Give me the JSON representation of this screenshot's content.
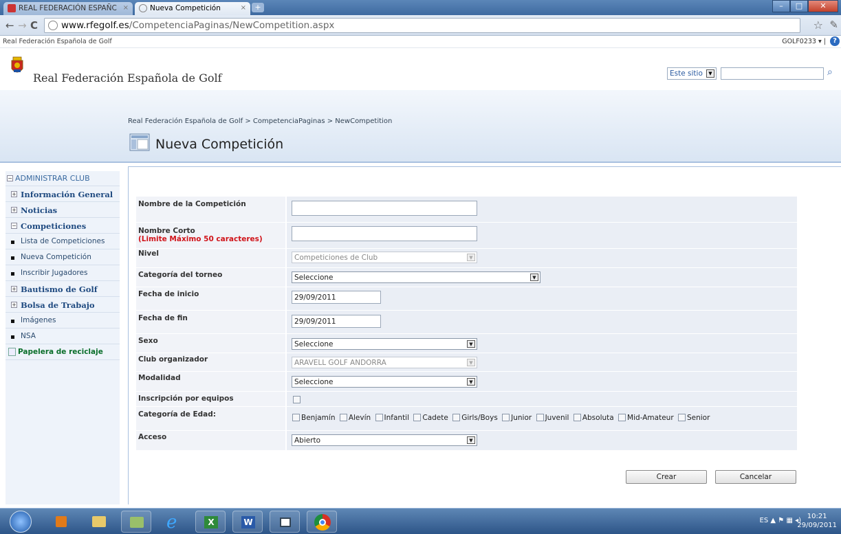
{
  "browser": {
    "tabs": [
      {
        "label": "REAL FEDERACIÓN ESPAÑC",
        "active": false
      },
      {
        "label": "Nueva Competición",
        "active": true
      }
    ],
    "url_domain": "www.rfegolf.es",
    "url_path": "/CompetenciaPaginas/NewCompetition.aspx"
  },
  "topbar": {
    "site_name": "Real Federación Española de Golf",
    "user": "GOLF0233 ▾ |"
  },
  "header": {
    "title": "Real Federación Española de Golf",
    "search_scope": "Este sitio",
    "search_value": ""
  },
  "titlearea": {
    "breadcrumb": "Real Federación Española de Golf > CompetenciaPaginas > NewCompetition",
    "page_title": "Nueva Competición"
  },
  "sidebar": {
    "items": [
      {
        "label": "ADMINISTRAR CLUB",
        "type": "top",
        "marker": "−"
      },
      {
        "label": "Información General",
        "type": "bold",
        "marker": "+"
      },
      {
        "label": "Noticias",
        "type": "bold",
        "marker": "+"
      },
      {
        "label": "Competiciones",
        "type": "bold",
        "marker": "−"
      },
      {
        "label": "Lista de Competiciones",
        "type": "sub"
      },
      {
        "label": "Nueva Competición",
        "type": "sub"
      },
      {
        "label": "Inscribir Jugadores",
        "type": "sub"
      },
      {
        "label": "Bautismo de Golf",
        "type": "bold",
        "marker": "+"
      },
      {
        "label": "Bolsa de Trabajo",
        "type": "bold",
        "marker": "+"
      },
      {
        "label": "Imágenes",
        "type": "sub"
      },
      {
        "label": "NSA",
        "type": "sub"
      },
      {
        "label": "Papelera de reciclaje",
        "type": "green"
      }
    ]
  },
  "form": {
    "nombre_label": "Nombre de la Competición",
    "nombre_value": "",
    "corto_label": "Nombre Corto",
    "corto_req": "(Limite Máximo 50 caracteres)",
    "corto_value": "",
    "nivel_label": "Nivel",
    "nivel_value": "Competiciones de Club",
    "categoria_label": "Categoría del torneo",
    "categoria_value": "Seleccione",
    "inicio_label": "Fecha de inicio",
    "inicio_value": "29/09/2011",
    "fin_label": "Fecha de fin",
    "fin_value": "29/09/2011",
    "sexo_label": "Sexo",
    "sexo_value": "Seleccione",
    "club_label": "Club organizador",
    "club_value": "ARAVELL GOLF ANDORRA",
    "modalidad_label": "Modalidad",
    "modalidad_value": "Seleccione",
    "equipos_label": "Inscripción por equipos",
    "edad_label": "Categoría de Edad:",
    "edad_options": [
      "Benjamín",
      "Alevín",
      "Infantil",
      "Cadete",
      "Girls/Boys",
      "Junior",
      "Juvenil",
      "Absoluta",
      "Mid-Amateur",
      "Senior"
    ],
    "acceso_label": "Acceso",
    "acceso_value": "Abierto",
    "crear_label": "Crear",
    "cancelar_label": "Cancelar"
  },
  "taskbar": {
    "lang": "ES",
    "time": "10:21",
    "date": "29/09/2011"
  }
}
